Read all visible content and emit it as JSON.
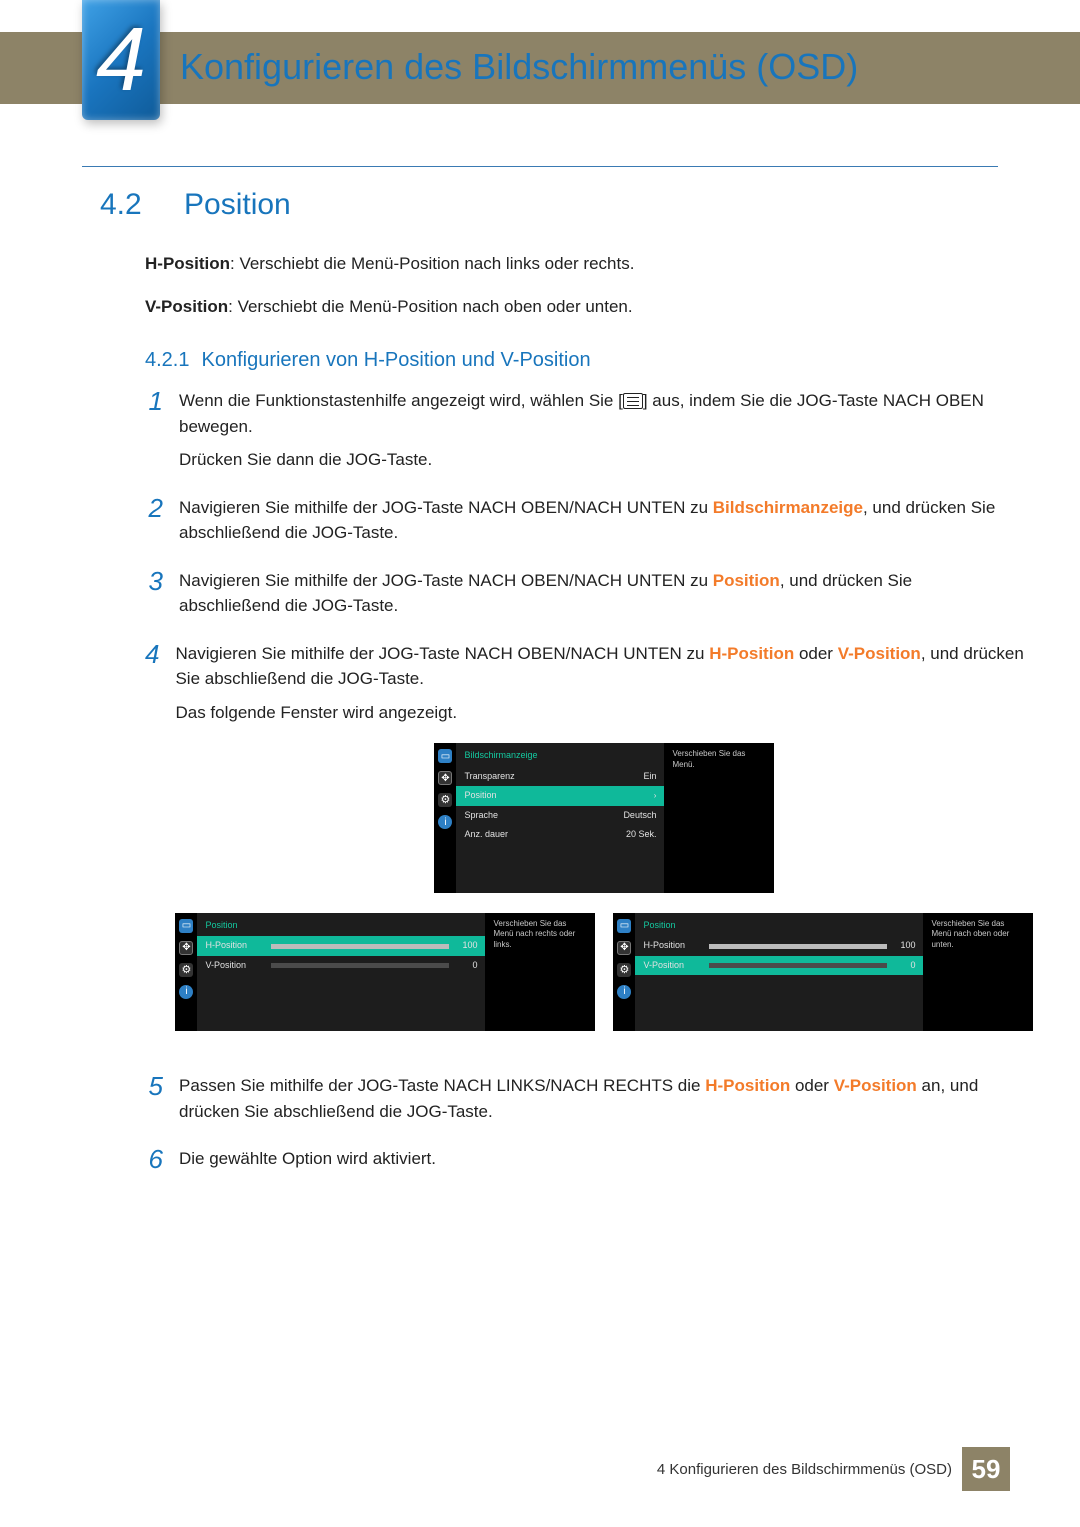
{
  "chapter": {
    "number": "4",
    "title": "Konfigurieren des Bildschirmmenüs (OSD)"
  },
  "section": {
    "number": "4.2",
    "title": "Position"
  },
  "intro": {
    "h_label": "H-Position",
    "h_text": ": Verschiebt die Menü-Position nach links oder rechts.",
    "v_label": "V-Position",
    "v_text": ": Verschiebt die Menü-Position nach oben oder unten."
  },
  "subsection": {
    "number": "4.2.1",
    "title": "Konfigurieren von H-Position und V-Position"
  },
  "steps": [
    {
      "n": "1",
      "a": "Wenn die Funktionstastenhilfe angezeigt wird, wählen Sie [",
      "b": "] aus, indem Sie die JOG-Taste NACH OBEN bewegen.",
      "c": "Drücken Sie dann die JOG-Taste."
    },
    {
      "n": "2",
      "a": "Navigieren Sie mithilfe der JOG-Taste NACH OBEN/NACH UNTEN zu ",
      "hl": "Bildschirmanzeige",
      "b": ", und drücken Sie abschließend die JOG-Taste."
    },
    {
      "n": "3",
      "a": "Navigieren Sie mithilfe der JOG-Taste NACH OBEN/NACH UNTEN zu ",
      "hl": "Position",
      "b": ", und drücken Sie abschließend die JOG-Taste."
    },
    {
      "n": "4",
      "a": "Navigieren Sie mithilfe der JOG-Taste NACH OBEN/NACH UNTEN zu ",
      "hl1": "H-Position",
      "mid": " oder ",
      "hl2": "V-Position",
      "b": ", und drücken Sie abschließend die JOG-Taste.",
      "c": "Das folgende Fenster wird angezeigt."
    },
    {
      "n": "5",
      "a": "Passen Sie mithilfe der JOG-Taste NACH LINKS/NACH RECHTS die ",
      "hl1": "H-Position",
      "mid": " oder ",
      "hl2": "V-Position",
      "b": " an, und drücken Sie abschließend die JOG-Taste."
    },
    {
      "n": "6",
      "a": "Die gewählte Option wird aktiviert."
    }
  ],
  "osd_top": {
    "header": "Bildschirmanzeige",
    "rows": [
      {
        "label": "Transparenz",
        "value": "Ein"
      },
      {
        "label": "Position",
        "value": "",
        "selected": true,
        "arrow": "›"
      },
      {
        "label": "Sprache",
        "value": "Deutsch"
      },
      {
        "label": "Anz. dauer",
        "value": "20 Sek."
      }
    ],
    "help": "Verschieben Sie das Menü."
  },
  "osd_h": {
    "header": "Position",
    "rows": [
      {
        "label": "H-Position",
        "value": "100",
        "selected": true,
        "fill": 100
      },
      {
        "label": "V-Position",
        "value": "0",
        "fill": 0
      }
    ],
    "help": "Verschieben Sie das Menü nach rechts oder links."
  },
  "osd_v": {
    "header": "Position",
    "rows": [
      {
        "label": "H-Position",
        "value": "100",
        "fill": 100
      },
      {
        "label": "V-Position",
        "value": "0",
        "selected": true,
        "fill": 0
      }
    ],
    "help": "Verschieben Sie das Menü nach oben oder unten."
  },
  "footer": {
    "text": "4 Konfigurieren des Bildschirmmenüs (OSD)",
    "page": "59"
  }
}
